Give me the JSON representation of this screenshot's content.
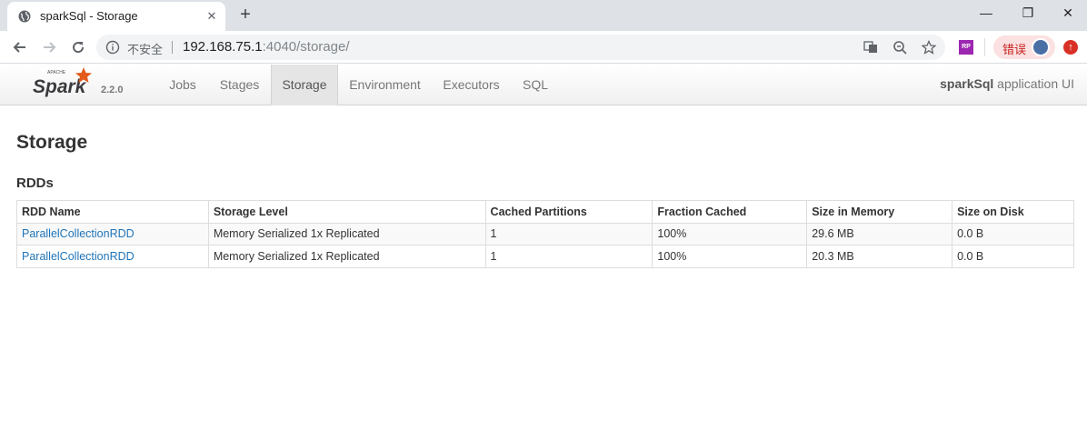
{
  "browser": {
    "tab_title": "sparkSql - Storage",
    "tab_close": "✕",
    "new_tab": "+",
    "window_minimize": "—",
    "window_restore": "❐",
    "window_close": "✕",
    "not_secure_label": "不安全",
    "url_host": "192.168.75.1",
    "url_rest": ":4040/storage/",
    "profile_label": "错误"
  },
  "navbar": {
    "logo_text": "Spark",
    "logo_apache": "APACHE",
    "version": "2.2.0",
    "items": [
      {
        "label": "Jobs",
        "active": false
      },
      {
        "label": "Stages",
        "active": false
      },
      {
        "label": "Storage",
        "active": true
      },
      {
        "label": "Environment",
        "active": false
      },
      {
        "label": "Executors",
        "active": false
      },
      {
        "label": "SQL",
        "active": false
      }
    ],
    "app_name": "sparkSql",
    "app_suffix": " application UI"
  },
  "page": {
    "title": "Storage",
    "section_title": "RDDs"
  },
  "table": {
    "headers": [
      "RDD Name",
      "Storage Level",
      "Cached Partitions",
      "Fraction Cached",
      "Size in Memory",
      "Size on Disk"
    ],
    "rows": [
      [
        "ParallelCollectionRDD",
        "Memory Serialized 1x Replicated",
        "1",
        "100%",
        "29.6 MB",
        "0.0 B"
      ],
      [
        "ParallelCollectionRDD",
        "Memory Serialized 1x Replicated",
        "1",
        "100%",
        "20.3 MB",
        "0.0 B"
      ]
    ]
  },
  "colors": {
    "accent_link": "#1f74b8",
    "spark_orange": "#e25a1c",
    "tabstrip": "#dee1e6"
  }
}
